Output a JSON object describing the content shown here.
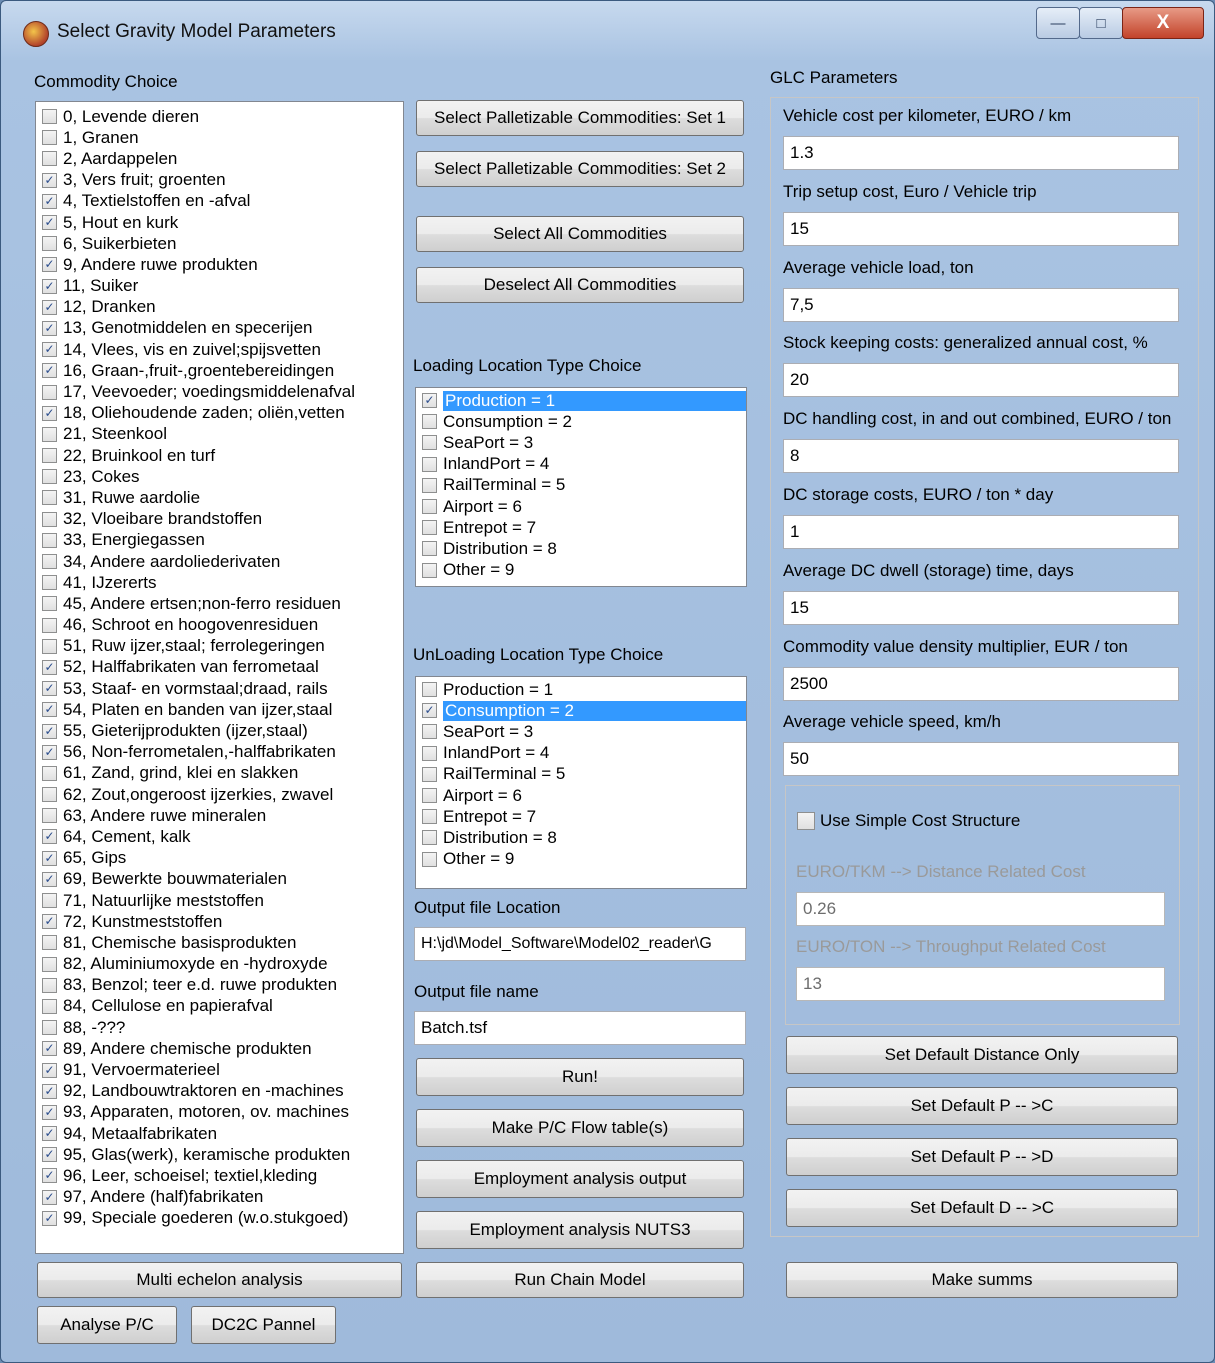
{
  "window": {
    "title": "Select Gravity Model Parameters",
    "min_glyph": "—",
    "max_glyph": "□",
    "close_glyph": "X"
  },
  "commodity": {
    "heading": "Commodity Choice",
    "items": [
      {
        "label": "0, Levende dieren",
        "checked": false
      },
      {
        "label": "1, Granen",
        "checked": false
      },
      {
        "label": "2, Aardappelen",
        "checked": false
      },
      {
        "label": "3, Vers fruit; groenten",
        "checked": true
      },
      {
        "label": "4, Textielstoffen en -afval",
        "checked": true
      },
      {
        "label": "5, Hout en kurk",
        "checked": true
      },
      {
        "label": "6, Suikerbieten",
        "checked": false
      },
      {
        "label": "9, Andere ruwe produkten",
        "checked": true
      },
      {
        "label": "11, Suiker",
        "checked": true
      },
      {
        "label": "12, Dranken",
        "checked": true
      },
      {
        "label": "13, Genotmiddelen en specerijen",
        "checked": true
      },
      {
        "label": "14, Vlees, vis en zuivel;spijsvetten",
        "checked": true
      },
      {
        "label": "16, Graan-,fruit-,groentebereidingen",
        "checked": true
      },
      {
        "label": "17, Veevoeder; voedingsmiddelenafval",
        "checked": false
      },
      {
        "label": "18, Oliehoudende zaden; oliën,vetten",
        "checked": true
      },
      {
        "label": "21, Steenkool",
        "checked": false
      },
      {
        "label": "22, Bruinkool en turf",
        "checked": false
      },
      {
        "label": "23, Cokes",
        "checked": false
      },
      {
        "label": "31, Ruwe aardolie",
        "checked": false
      },
      {
        "label": "32, Vloeibare brandstoffen",
        "checked": false
      },
      {
        "label": "33, Energiegassen",
        "checked": false
      },
      {
        "label": "34, Andere aardoliederivaten",
        "checked": false
      },
      {
        "label": "41, IJzererts",
        "checked": false
      },
      {
        "label": "45, Andere ertsen;non-ferro residuen",
        "checked": false
      },
      {
        "label": "46, Schroot en hoogovenresiduen",
        "checked": false
      },
      {
        "label": "51, Ruw ijzer,staal; ferrolegeringen",
        "checked": false
      },
      {
        "label": "52, Halffabrikaten van ferrometaal",
        "checked": true
      },
      {
        "label": "53, Staaf- en vormstaal;draad, rails",
        "checked": true
      },
      {
        "label": "54, Platen en banden van ijzer,staal",
        "checked": true
      },
      {
        "label": "55, Gieterijprodukten (ijzer,staal)",
        "checked": true
      },
      {
        "label": "56, Non-ferrometalen,-halffabrikaten",
        "checked": true
      },
      {
        "label": "61, Zand, grind, klei en slakken",
        "checked": false
      },
      {
        "label": "62, Zout,ongeroost ijzerkies, zwavel",
        "checked": false
      },
      {
        "label": "63, Andere ruwe mineralen",
        "checked": false
      },
      {
        "label": "64, Cement, kalk",
        "checked": true
      },
      {
        "label": "65, Gips",
        "checked": true
      },
      {
        "label": "69, Bewerkte bouwmaterialen",
        "checked": true
      },
      {
        "label": "71, Natuurlijke meststoffen",
        "checked": false
      },
      {
        "label": "72, Kunstmeststoffen",
        "checked": true
      },
      {
        "label": "81, Chemische basisprodukten",
        "checked": false
      },
      {
        "label": "82, Aluminiumoxyde en -hydroxyde",
        "checked": false
      },
      {
        "label": "83, Benzol; teer e.d. ruwe produkten",
        "checked": false
      },
      {
        "label": "84, Cellulose en papierafval",
        "checked": false
      },
      {
        "label": "88, -???",
        "checked": false
      },
      {
        "label": "89, Andere chemische produkten",
        "checked": true
      },
      {
        "label": "91, Vervoermaterieel",
        "checked": true
      },
      {
        "label": "92, Landbouwtraktoren en -machines",
        "checked": true
      },
      {
        "label": "93, Apparaten, motoren, ov. machines",
        "checked": true
      },
      {
        "label": "94, Metaalfabrikaten",
        "checked": true
      },
      {
        "label": "95, Glas(werk), keramische produkten",
        "checked": true
      },
      {
        "label": "96, Leer, schoeisel; textiel,kleding",
        "checked": true
      },
      {
        "label": "97, Andere (half)fabrikaten",
        "checked": true
      },
      {
        "label": "99, Speciale goederen (w.o.stukgoed)",
        "checked": true
      }
    ]
  },
  "middle": {
    "btn_set1": "Select Palletizable Commodities: Set 1",
    "btn_set2": "Select Palletizable Commodities: Set 2",
    "btn_select_all": "Select All Commodities",
    "btn_deselect_all": "Deselect All Commodities",
    "loading_heading": "Loading Location Type Choice",
    "loading_items": [
      {
        "label": "Production = 1",
        "checked": true,
        "selected": true
      },
      {
        "label": "Consumption = 2",
        "checked": false,
        "selected": false
      },
      {
        "label": "SeaPort = 3",
        "checked": false,
        "selected": false
      },
      {
        "label": "InlandPort = 4",
        "checked": false,
        "selected": false
      },
      {
        "label": "RailTerminal = 5",
        "checked": false,
        "selected": false
      },
      {
        "label": "Airport = 6",
        "checked": false,
        "selected": false
      },
      {
        "label": "Entrepot = 7",
        "checked": false,
        "selected": false
      },
      {
        "label": "Distribution = 8",
        "checked": false,
        "selected": false
      },
      {
        "label": "Other = 9",
        "checked": false,
        "selected": false
      }
    ],
    "unloading_heading": "UnLoading Location Type Choice",
    "unloading_items": [
      {
        "label": "Production = 1",
        "checked": false,
        "selected": false
      },
      {
        "label": "Consumption = 2",
        "checked": true,
        "selected": true
      },
      {
        "label": "SeaPort = 3",
        "checked": false,
        "selected": false
      },
      {
        "label": "InlandPort = 4",
        "checked": false,
        "selected": false
      },
      {
        "label": "RailTerminal = 5",
        "checked": false,
        "selected": false
      },
      {
        "label": "Airport = 6",
        "checked": false,
        "selected": false
      },
      {
        "label": "Entrepot = 7",
        "checked": false,
        "selected": false
      },
      {
        "label": "Distribution = 8",
        "checked": false,
        "selected": false
      },
      {
        "label": "Other = 9",
        "checked": false,
        "selected": false
      }
    ],
    "output_location_label": "Output file Location",
    "output_location_value": "H:\\jd\\Model_Software\\Model02_reader\\G",
    "output_name_label": "Output file name",
    "output_name_value": "Batch.tsf",
    "btn_run": "Run!",
    "btn_flow": "Make P/C Flow table(s)",
    "btn_employment": "Employment analysis output",
    "btn_nuts3": "Employment analysis NUTS3"
  },
  "glc": {
    "heading": "GLC Parameters",
    "params": [
      {
        "label": "Vehicle cost per kilometer, EURO / km",
        "value": "1.3"
      },
      {
        "label": "Trip setup cost, Euro / Vehicle trip",
        "value": "15"
      },
      {
        "label": "Average vehicle load, ton",
        "value": "7,5"
      },
      {
        "label": "Stock keeping costs: generalized annual cost, %",
        "value": "20"
      },
      {
        "label": "DC handling cost, in and out combined, EURO / ton",
        "value": "8"
      },
      {
        "label": "DC storage costs, EURO / ton * day",
        "value": "1"
      },
      {
        "label": "Average DC dwell (storage) time, days",
        "value": "15"
      },
      {
        "label": "Commodity value density multiplier, EUR / ton",
        "value": "2500"
      },
      {
        "label": "Average vehicle speed, km/h",
        "value": "50"
      }
    ],
    "simple_cost_label": "Use Simple Cost Structure",
    "simple_cost_checked": false,
    "distance_cost_label": "EURO/TKM --> Distance Related Cost",
    "distance_cost_value": "0.26",
    "throughput_cost_label": "EURO/TON --> Throughput Related Cost",
    "throughput_cost_value": "13",
    "btn_default_distance": "Set Default Distance Only",
    "btn_default_pc": "Set Default P -- >C",
    "btn_default_pd": "Set Default P -- >D",
    "btn_default_dc": "Set Default D -- >C"
  },
  "bottom": {
    "btn_multi_echelon": "Multi echelon analysis",
    "btn_run_chain": "Run Chain Model",
    "btn_make_summs": "Make summs",
    "btn_analyse_pc": "Analyse P/C",
    "btn_dc2c": "DC2C Pannel"
  }
}
